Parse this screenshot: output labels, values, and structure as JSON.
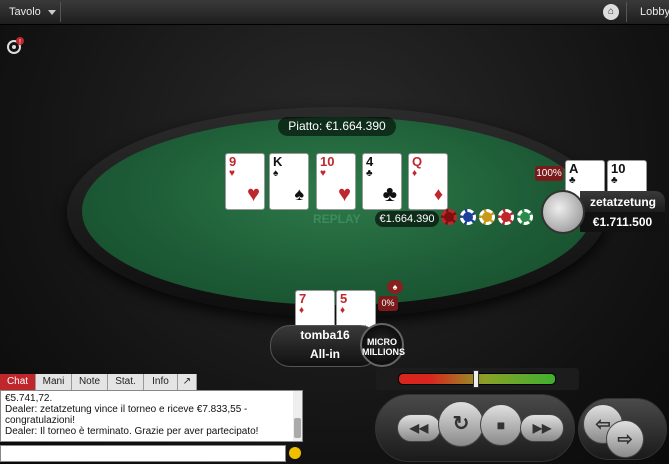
{
  "topbar": {
    "menu_label": "Tavolo",
    "lobby_label": "Lobby"
  },
  "table": {
    "pot_label": "Piatto: €1.664.390",
    "replay_label": "REPLAY",
    "bet_amount": "€1.664.390"
  },
  "board": [
    {
      "rank": "9",
      "suit": "♥",
      "color": "red"
    },
    {
      "rank": "K",
      "suit": "♠",
      "color": "blk"
    },
    {
      "rank": "10",
      "suit": "♥",
      "color": "red"
    },
    {
      "rank": "4",
      "suit": "♣",
      "color": "blk"
    },
    {
      "rank": "Q",
      "suit": "♦",
      "color": "red"
    }
  ],
  "opponent": {
    "name": "zetatzetung",
    "stack": "€1.711.500",
    "equity": "100%",
    "cards": [
      {
        "rank": "A",
        "suit": "♣",
        "color": "blk"
      },
      {
        "rank": "10",
        "suit": "♣",
        "color": "blk"
      }
    ]
  },
  "hero": {
    "name": "tomba16",
    "status": "All-in",
    "equity": "0%",
    "cards": [
      {
        "rank": "7",
        "suit": "♦",
        "color": "red"
      },
      {
        "rank": "5",
        "suit": "♦",
        "color": "red"
      }
    ],
    "brand": "MICRO MILLIONS"
  },
  "chat": {
    "tabs": [
      "Chat",
      "Mani",
      "Note",
      "Stat.",
      "Info",
      "↗"
    ],
    "lines": [
      "€5.741,72.",
      "Dealer: zetatzetung vince il torneo e riceve €7.833,55 -",
      "congratulazioni!",
      "Dealer: Il torneo è terminato. Grazie per aver partecipato!"
    ]
  },
  "icons": {
    "menu": "chevron-down-icon",
    "lobby": "lobby-icon",
    "ask": "question-icon",
    "rewind": "rewind-icon",
    "replay": "replay-icon",
    "stop": "stop-icon",
    "forward": "fast-forward-icon",
    "prev": "prev-hand-icon",
    "next": "next-hand-icon",
    "smiley": "emoji-icon"
  }
}
